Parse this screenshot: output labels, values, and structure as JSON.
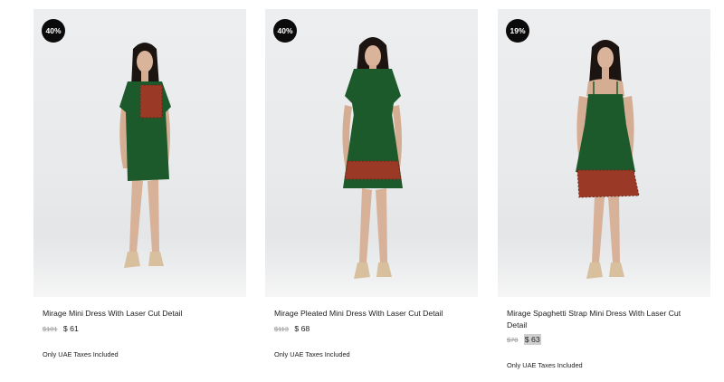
{
  "products": [
    {
      "discount": "40%",
      "title": "Mirage Mini Dress With Laser Cut Detail",
      "old_price": "$101",
      "price": "$ 61",
      "tax_note": "Only UAE Taxes Included"
    },
    {
      "discount": "40%",
      "title": "Mirage Pleated Mini Dress With Laser Cut Detail",
      "old_price": "$113",
      "price": "$ 68",
      "tax_note": "Only UAE Taxes Included"
    },
    {
      "discount": "19%",
      "title": "Mirage Spaghetti Strap Mini Dress With Laser Cut Detail",
      "old_price": "$78",
      "price": "$ 63",
      "tax_note": "Only UAE Taxes Included"
    }
  ],
  "colors": {
    "dress_green": "#1c5a2c",
    "laser_cut": "#9a3a26",
    "badge_bg": "#0b0b0b"
  }
}
